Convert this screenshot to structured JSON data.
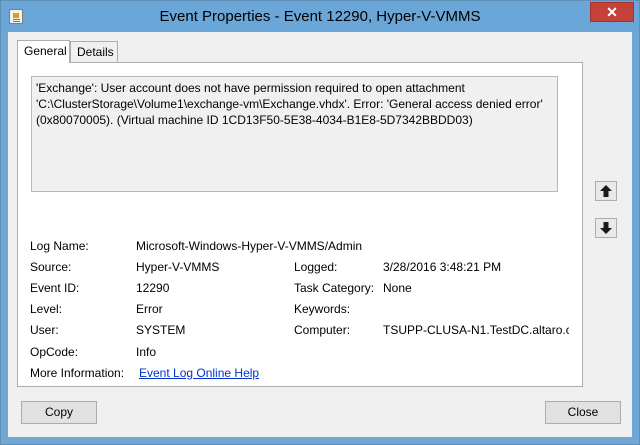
{
  "window": {
    "title": "Event Properties - Event 12290, Hyper-V-VMMS",
    "close_glyph": "✕"
  },
  "tabs": [
    {
      "label": "General",
      "selected": true
    },
    {
      "label": "Details",
      "selected": false
    }
  ],
  "message": "'Exchange': User account does not have permission required to open attachment 'C:\\ClusterStorage\\Volume1\\exchange-vm\\Exchange.vhdx'. Error: 'General access denied error' (0x80070005). (Virtual machine ID 1CD13F50-5E38-4034-B1E8-5D7342BBDD03)",
  "fields": {
    "log_name_label": "Log Name:",
    "log_name_value": "Microsoft-Windows-Hyper-V-VMMS/Admin",
    "source_label": "Source:",
    "source_value": "Hyper-V-VMMS",
    "logged_label": "Logged:",
    "logged_value": "3/28/2016 3:48:21 PM",
    "event_id_label": "Event ID:",
    "event_id_value": "12290",
    "task_category_label": "Task Category:",
    "task_category_value": "None",
    "level_label": "Level:",
    "level_value": "Error",
    "keywords_label": "Keywords:",
    "keywords_value": "",
    "user_label": "User:",
    "user_value": "SYSTEM",
    "computer_label": "Computer:",
    "computer_value": "TSUPP-CLUSA-N1.TestDC.altaro.c",
    "opcode_label": "OpCode:",
    "opcode_value": "Info",
    "more_info_label": "More Information:",
    "more_info_link": "Event Log Online Help"
  },
  "buttons": {
    "copy": "Copy",
    "close": "Close"
  },
  "icons": {
    "title_icon": "event-viewer-icon",
    "up": "arrow-up-icon",
    "down": "arrow-down-icon"
  },
  "colors": {
    "titlebar": "#6ba6d8",
    "close_button": "#c7413b",
    "link": "#0033cc"
  }
}
